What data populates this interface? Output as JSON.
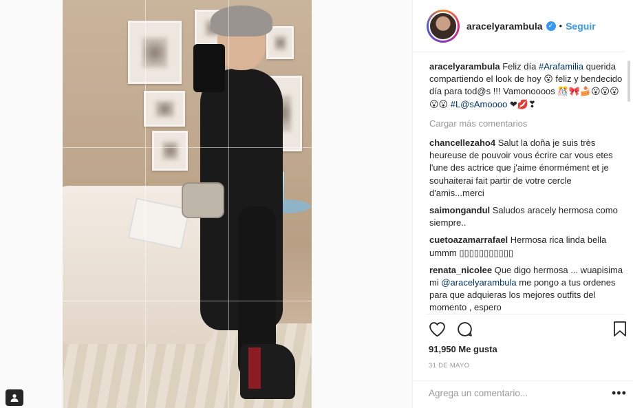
{
  "post": {
    "username": "aracelyarambula",
    "follow_label": "Seguir",
    "separator": "•"
  },
  "caption": {
    "user": "aracelyarambula",
    "text_1": " Feliz día ",
    "hashtag_1": "#Arafamilia",
    "text_2": " querida compartiendo el look de hoy 😮 feliz y bendecido día para tod@s !!! Vamonoooos 🎊🎀🍰😮😮😮😮😮 ",
    "hashtag_2": "#L@sAmoooo",
    "text_3": " ❤💋❣"
  },
  "load_more_label": "Cargar más comentarios",
  "comments": [
    {
      "user": "chancellezaho4",
      "text": "Salut la doña je suis très heureuse de pouvoir vous écrire car vous etes l'une des actrice que j'aime énormément et je souhaiterai fait partir de votre cercle d'amis...merci"
    },
    {
      "user": "saimongandul",
      "text": "Saludos aracely hermosa como siempre.."
    },
    {
      "user": "cuetoazamarrafael",
      "text": "Hermosa rica linda bella ummm ▯▯▯▯▯▯▯▯▯▯▯"
    },
    {
      "user": "renata_nicolee",
      "text_1": "Que digo hermosa ... wuapisima mi ",
      "mention": "@aracelyarambula",
      "text_2": " me pongo a tus ordenes para que adquieras los mejores outfits del momento , espero"
    }
  ],
  "likes_label": "91,950 Me gusta",
  "date_label": "31 DE MAYO",
  "add_comment_placeholder": "Agrega un comentario...",
  "more_label": "•••",
  "colors": {
    "link_blue": "#3897f0",
    "hashtag": "#003569",
    "muted": "#999999",
    "text": "#262626"
  },
  "icons": {
    "heart": "heart-icon",
    "comment": "comment-icon",
    "bookmark": "bookmark-icon",
    "user_tag": "user-tag-icon",
    "verified": "verified-badge-icon"
  }
}
